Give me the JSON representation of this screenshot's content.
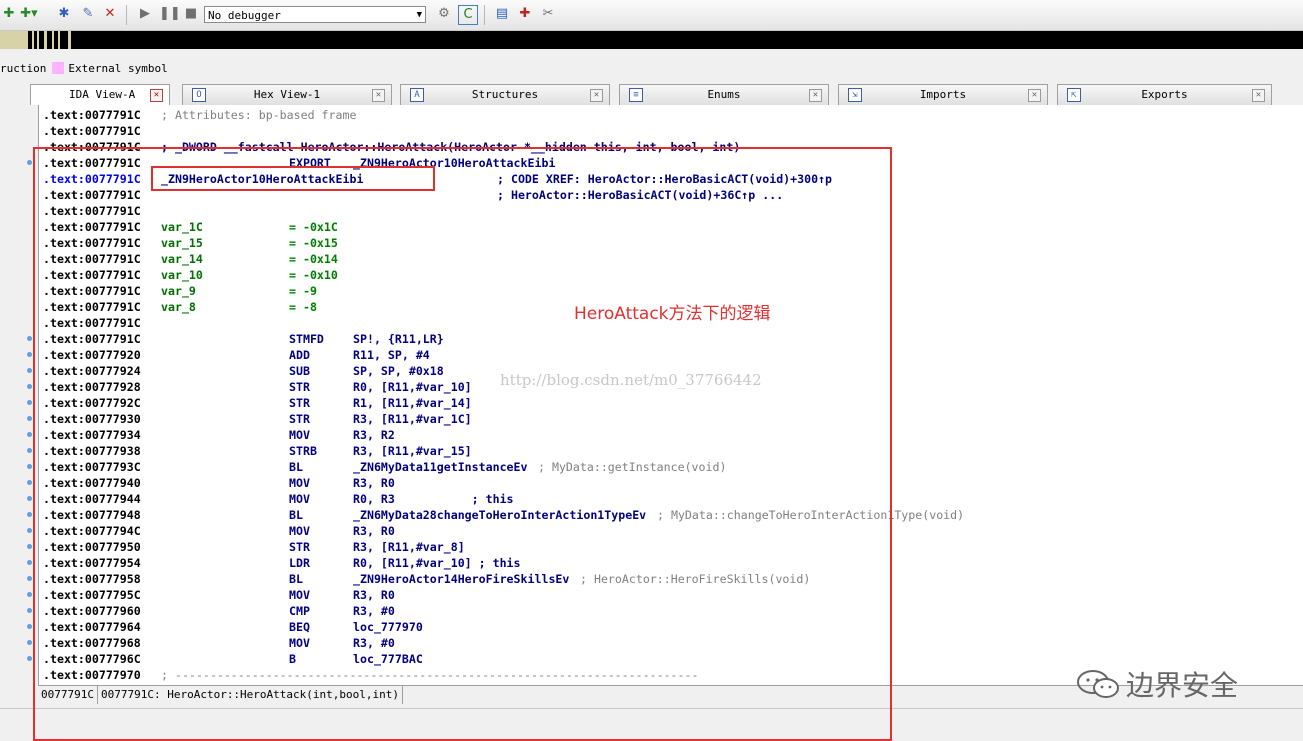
{
  "toolbar": {
    "debugger_select": "No debugger",
    "icons": [
      "add-icon",
      "add-dropdown-icon",
      "plugin-icon",
      "edit-icon",
      "delete-icon",
      "play-icon",
      "pause-icon",
      "stop-icon",
      "settings-icon",
      "code-icon",
      "view-icon",
      "breakpoint-icon",
      "tools-icon"
    ]
  },
  "legend": {
    "prefix": "ruction",
    "label": "External symbol",
    "color": "#ffb3ff"
  },
  "tabs": [
    {
      "label": "IDA View-A",
      "active": true
    },
    {
      "label": "Hex View-1",
      "active": false
    },
    {
      "label": "Structures",
      "active": false
    },
    {
      "label": "Enums",
      "active": false
    },
    {
      "label": "Imports",
      "active": false
    },
    {
      "label": "Exports",
      "active": false
    }
  ],
  "listing": [
    {
      "addr": ".text:0077791C",
      "comment": "; Attributes: bp-based frame"
    },
    {
      "addr": ".text:0077791C",
      "text": ""
    },
    {
      "addr": ".text:0077791C",
      "decl": "; _DWORD __fastcall HeroActor::HeroAttack(HeroActor *__hidden this, int, bool, int)"
    },
    {
      "addr": ".text:0077791C",
      "mn": "EXPORT",
      "op": "_ZN9HeroActor10HeroAttackEibi"
    },
    {
      "addr": ".text:0077791C",
      "label": "_ZN9HeroActor10HeroAttackEibi",
      "xref": "; CODE XREF: HeroActor::HeroBasicACT(void)+300↑p"
    },
    {
      "addr": ".text:0077791C",
      "xref2": "; HeroActor::HeroBasicACT(void)+36C↑p ..."
    },
    {
      "addr": ".text:0077791C",
      "text": ""
    },
    {
      "addr": ".text:0077791C",
      "var": "var_1C",
      "val": "= -0x1C"
    },
    {
      "addr": ".text:0077791C",
      "var": "var_15",
      "val": "= -0x15"
    },
    {
      "addr": ".text:0077791C",
      "var": "var_14",
      "val": "= -0x14"
    },
    {
      "addr": ".text:0077791C",
      "var": "var_10",
      "val": "= -0x10"
    },
    {
      "addr": ".text:0077791C",
      "var": "var_9",
      "val": "= -9"
    },
    {
      "addr": ".text:0077791C",
      "var": "var_8",
      "val": "= -8"
    },
    {
      "addr": ".text:0077791C",
      "text": ""
    },
    {
      "addr": ".text:0077791C",
      "mn": "STMFD",
      "op": "SP!, {R11,LR}"
    },
    {
      "addr": ".text:00777920",
      "mn": "ADD",
      "op": "R11, SP, #4"
    },
    {
      "addr": ".text:00777924",
      "mn": "SUB",
      "op": "SP, SP, #0x18"
    },
    {
      "addr": ".text:00777928",
      "mn": "STR",
      "op": "R0, [R11,#var_10]"
    },
    {
      "addr": ".text:0077792C",
      "mn": "STR",
      "op": "R1, [R11,#var_14]"
    },
    {
      "addr": ".text:00777930",
      "mn": "STR",
      "op": "R3, [R11,#var_1C]"
    },
    {
      "addr": ".text:00777934",
      "mn": "MOV",
      "op": "R3, R2"
    },
    {
      "addr": ".text:00777938",
      "mn": "STRB",
      "op": "R3, [R11,#var_15]"
    },
    {
      "addr": ".text:0077793C",
      "mn": "BL",
      "op": "_ZN6MyData11getInstanceEv",
      "cmt": "; MyData::getInstance(void)"
    },
    {
      "addr": ".text:00777940",
      "mn": "MOV",
      "op": "R3, R0"
    },
    {
      "addr": ".text:00777944",
      "mn": "MOV",
      "op": "R0, R3           ; this"
    },
    {
      "addr": ".text:00777948",
      "mn": "BL",
      "op": "_ZN6MyData28changeToHeroInterAction1TypeEv",
      "cmt": "; MyData::changeToHeroInterAction1Type(void)"
    },
    {
      "addr": ".text:0077794C",
      "mn": "MOV",
      "op": "R3, R0"
    },
    {
      "addr": ".text:00777950",
      "mn": "STR",
      "op": "R3, [R11,#var_8]"
    },
    {
      "addr": ".text:00777954",
      "mn": "LDR",
      "op": "R0, [R11,#var_10] ; this"
    },
    {
      "addr": ".text:00777958",
      "mn": "BL",
      "op": "_ZN9HeroActor14HeroFireSkillsEv",
      "cmt": "; HeroActor::HeroFireSkills(void)"
    },
    {
      "addr": ".text:0077795C",
      "mn": "MOV",
      "op": "R3, R0"
    },
    {
      "addr": ".text:00777960",
      "mn": "CMP",
      "op": "R3, #0"
    },
    {
      "addr": ".text:00777964",
      "mn": "BEQ",
      "op": "loc_777970"
    },
    {
      "addr": ".text:00777968",
      "mn": "MOV",
      "op": "R3, #0"
    },
    {
      "addr": ".text:0077796C",
      "mn": "B",
      "op": "loc_777BAC"
    },
    {
      "addr": ".text:00777970",
      "comment": "; ---------------------------------------------------------------------------"
    }
  ],
  "status": {
    "offset": "0077791C",
    "location": "0077791C: HeroActor::HeroAttack(int,bool,int)"
  },
  "annotation": "HeroAttack方法下的逻辑",
  "watermark": "http://blog.csdn.net/m0_37766442",
  "brand": "边界安全",
  "colors": {
    "highlight_box": "#e03030",
    "address_blue": "#0000ee",
    "code_navy": "#000080",
    "var_green": "#007000"
  }
}
